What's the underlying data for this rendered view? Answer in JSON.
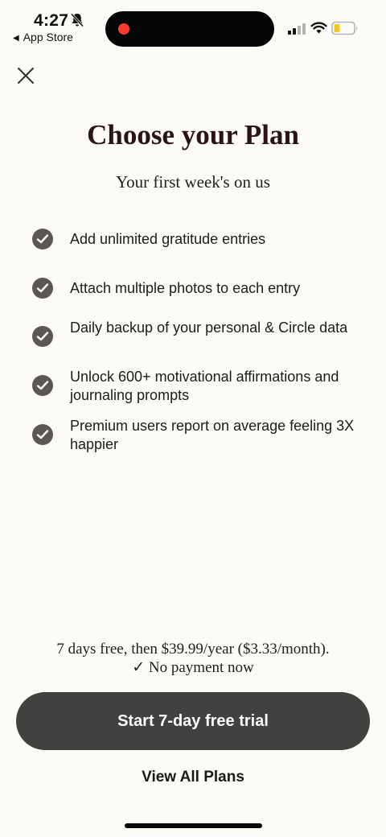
{
  "status_bar": {
    "time": "4:27",
    "back_app": "App Store"
  },
  "header": {
    "title": "Choose your Plan",
    "subtitle": "Your first week's on us"
  },
  "features": [
    {
      "text": "Add unlimited gratitude entries"
    },
    {
      "text": "Attach multiple photos to each entry"
    },
    {
      "text": "Daily backup of your personal & Circle data"
    },
    {
      "text": "Unlock 600+ motivational affirmations and journaling prompts"
    },
    {
      "text": "Premium users report on average feeling 3X happier"
    }
  ],
  "pricing": {
    "line": "7 days free, then $39.99/year ($3.33/month).",
    "no_payment": "✓ No payment now"
  },
  "actions": {
    "trial_label": "Start 7-day free trial",
    "view_plans_label": "View All Plans"
  },
  "icons": {
    "close": "close-icon",
    "check": "check-circle-icon"
  },
  "colors": {
    "background": "#fdfbf6",
    "button": "#434140",
    "check": "#5a5754",
    "title": "#2a1418"
  }
}
